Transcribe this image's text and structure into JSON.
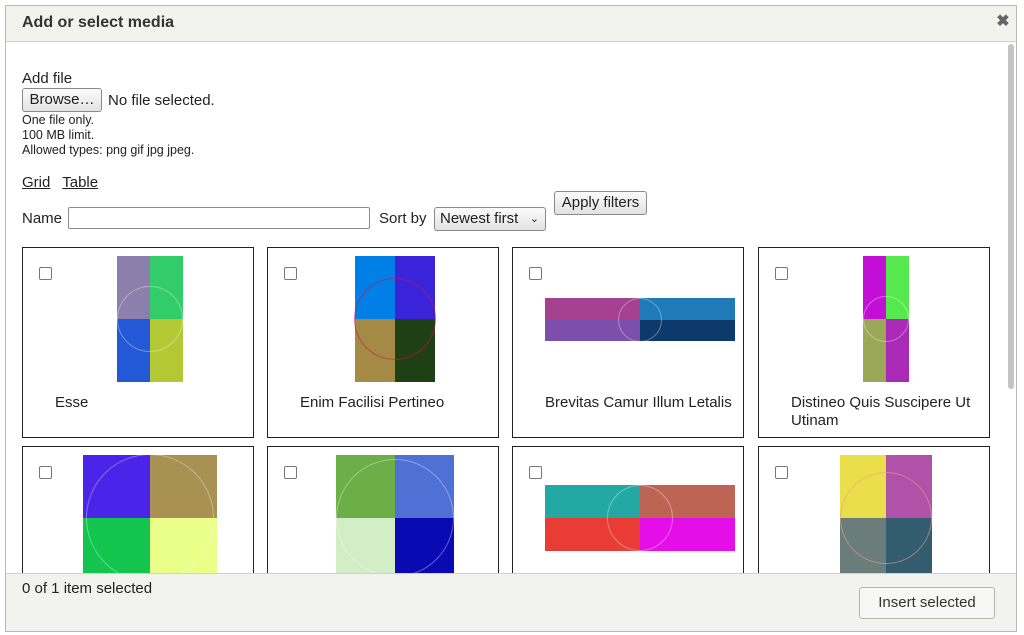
{
  "dialog": {
    "title": "Add or select media"
  },
  "upload": {
    "label": "Add file",
    "browse_label": "Browse…",
    "no_file": "No file selected.",
    "description": [
      "One file only.",
      "100 MB limit.",
      "Allowed types: png gif jpg jpeg."
    ]
  },
  "views": {
    "grid": "Grid",
    "table": "Table"
  },
  "filters": {
    "name_label": "Name",
    "name_value": "",
    "sort_label": "Sort by",
    "sort_value": "Newest first",
    "apply_label": "Apply filters"
  },
  "media": [
    {
      "caption": "Esse",
      "colors": [
        "#8c7fab",
        "#33cc6a",
        "#2359d6",
        "#b2c933"
      ]
    },
    {
      "caption": "Enim Facilisi Pertineo",
      "colors": [
        "#0080e6",
        "#3a24d9",
        "#a48a45",
        "#1e4014"
      ]
    },
    {
      "caption": "Brevitas Camur Illum Letalis",
      "colors": [
        "#a6418f",
        "#1f7ab8",
        "#7d4fac",
        "#0d3a6a"
      ]
    },
    {
      "caption": "Distineo Quis Suscipere Ut Utinam",
      "colors": [
        "#c20fd6",
        "#55e84f",
        "#9aa857",
        "#aa29b6"
      ]
    },
    {
      "caption": "",
      "colors": [
        "#4a24e8",
        "#a89152",
        "#13c44e",
        "#eaff88"
      ]
    },
    {
      "caption": "",
      "colors": [
        "#6cae47",
        "#4f71d6",
        "#d3edc6",
        "#0a0ab3"
      ]
    },
    {
      "caption": "",
      "colors": [
        "#23a8a4",
        "#bd6455",
        "#e83c35",
        "#e60ee8"
      ]
    },
    {
      "caption": "",
      "colors": [
        "#eade4a",
        "#b052a8",
        "#6b7d7b",
        "#335c6e"
      ]
    }
  ],
  "footer": {
    "status": "0 of 1 item selected",
    "insert_label": "Insert selected"
  }
}
